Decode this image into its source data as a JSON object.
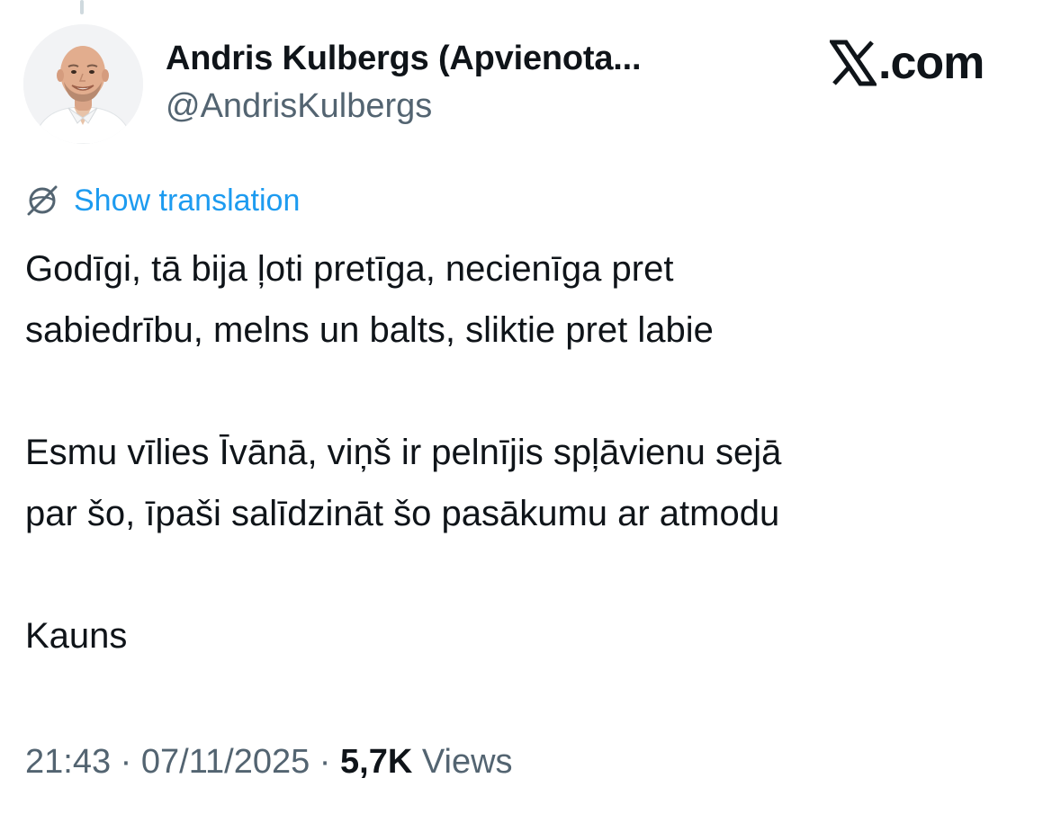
{
  "author": {
    "display_name": "Andris Kulbergs (Apvienota...",
    "handle": "@AndrisKulbergs"
  },
  "brand": {
    "text": ".com",
    "icon": "x-logo-icon"
  },
  "translate": {
    "label": "Show translation",
    "icon": "globe-icon",
    "color": "#1d9bf0"
  },
  "tweet": {
    "lines": [
      "Godīgi, tā bija ļoti pretīga, necienīga pret",
      "sabiedrību, melns un balts, sliktie pret labie",
      "Esmu vīlies Īvānā, viņš ir pelnījis spļāvienu sejā",
      "par šo, īpaši salīdzināt šo pasākumu ar atmodu",
      "Kauns"
    ]
  },
  "meta": {
    "time": "21:43",
    "separator": " · ",
    "date": "07/11/2025",
    "views_count": "5,7K",
    "views_label": " Views"
  },
  "colors": {
    "text_primary": "#0f1419",
    "text_secondary": "#536471",
    "link": "#1d9bf0",
    "divider": "#cfd9de"
  }
}
